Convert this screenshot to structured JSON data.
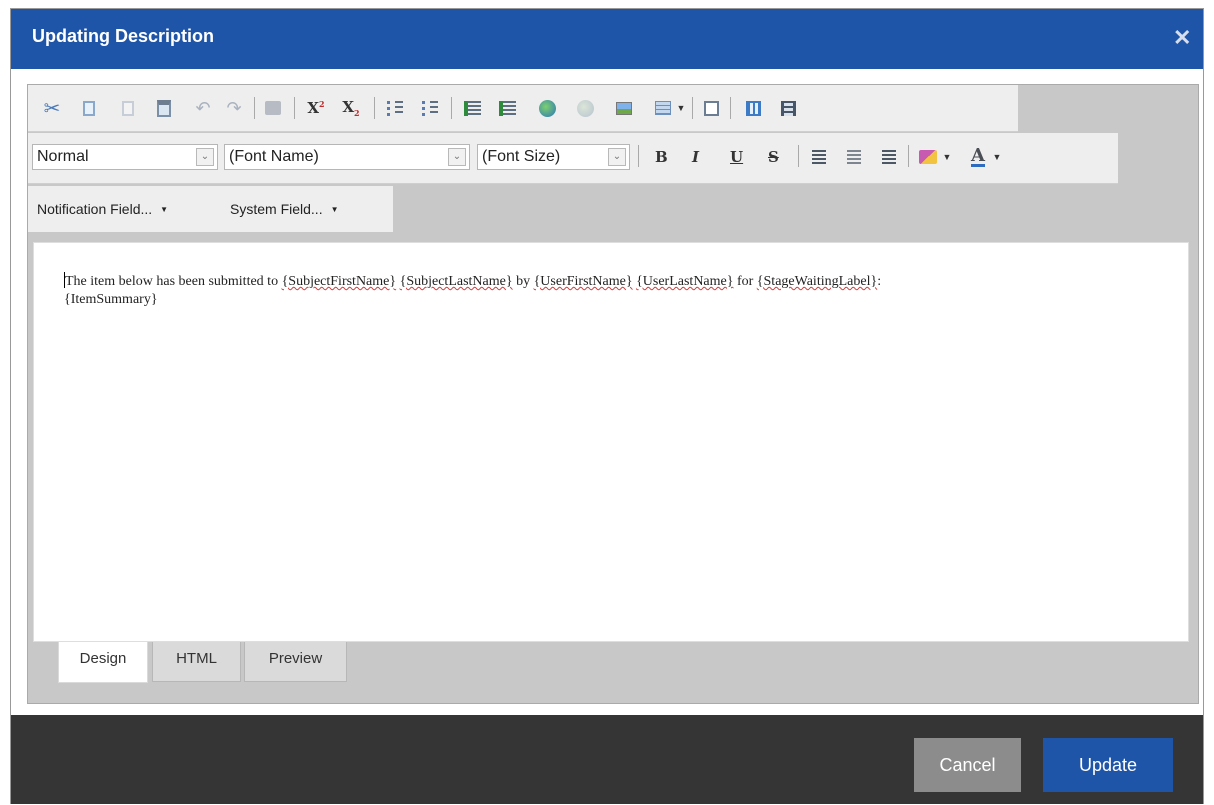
{
  "dialog": {
    "title": "Updating Description",
    "close_glyph": "✕"
  },
  "toolbar": {
    "row1_icons": [
      "cut-icon",
      "copy-icon",
      "paste-plain-icon",
      "paste-icon",
      "undo-icon",
      "redo-icon",
      "format-stripper-icon",
      "superscript-icon",
      "subscript-icon",
      "ordered-list-icon",
      "unordered-list-icon",
      "indent-icon",
      "outdent-icon",
      "hyperlink-icon",
      "remove-link-icon",
      "image-icon",
      "table-icon",
      "find-replace-icon",
      "module-manager-icon",
      "columns-icon"
    ],
    "superscript_label": "X",
    "superscript_mark": "2",
    "subscript_label": "X",
    "subscript_mark": "2",
    "paragraph_style": "Normal",
    "font_name": "(Font Name)",
    "font_size": "(Font Size)",
    "bold": "B",
    "italic": "I",
    "underline": "U",
    "strike": "S",
    "font_color": "A",
    "notification_fields": "Notification Field...",
    "system_fields": "System Field..."
  },
  "content": {
    "text_before": "The item below has been submitted to ",
    "token1": "{SubjectFirstName}",
    "token2": "{SubjectLastName}",
    "text_by": " by ",
    "token3": "{UserFirstName}",
    "token4": "{UserLastName}",
    "text_for": " for ",
    "token5": "{StageWaitingLabel}",
    "text_colon": ":",
    "token6": "{ItemSummary}"
  },
  "tabs": [
    "Design",
    "HTML",
    "Preview"
  ],
  "buttons": {
    "cancel": "Cancel",
    "update": "Update"
  },
  "colors": {
    "title_bar": "#1f55a8",
    "update_button": "#1f55a8",
    "cancel_button": "#8c8c8c",
    "footer": "#353535"
  }
}
